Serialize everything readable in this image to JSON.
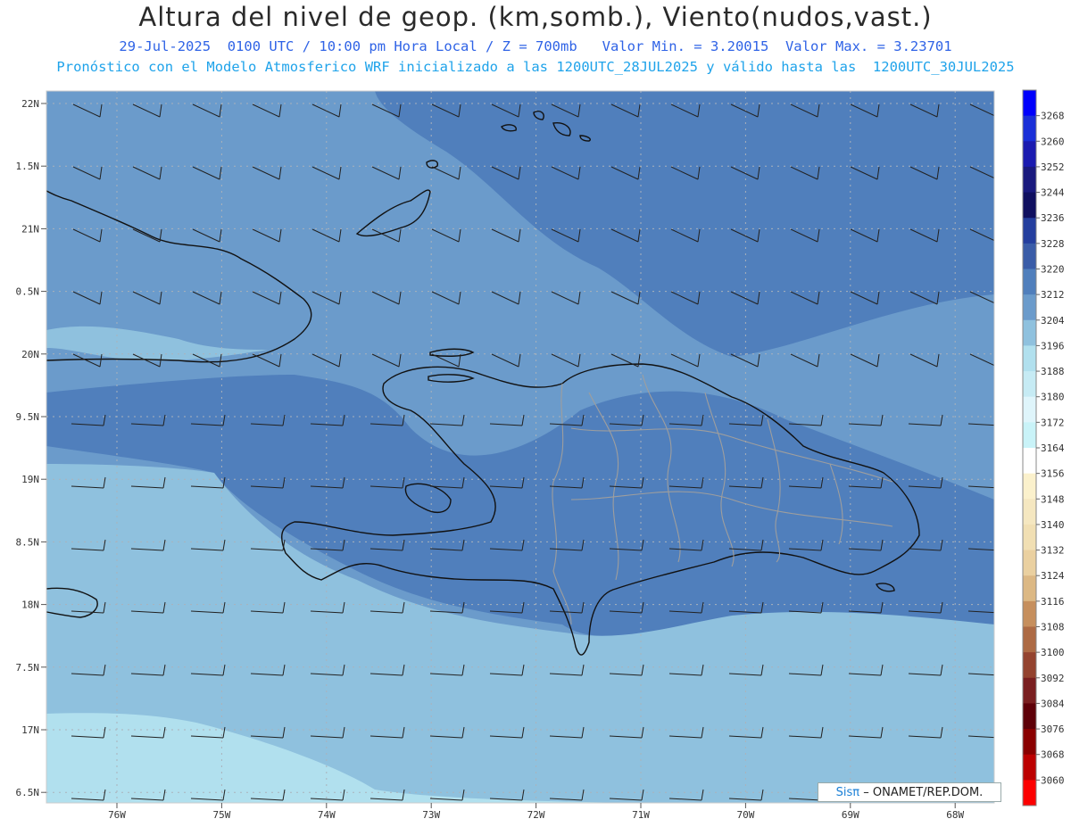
{
  "header": {
    "title": "Altura del nivel de geop. (km,somb.), Viento(nudos,vast.)",
    "line2": "29-Jul-2025  0100 UTC / 10:00 pm Hora Local / Z = 700mb   Valor Min. = 3.20015  Valor Max. = 3.23701",
    "line3": "Pronóstico con el Modelo Atmosferico WRF inicializado a las 1200UTC_28JUL2025 y válido hasta las  1200UTC_30JUL2025"
  },
  "map": {
    "lat_labels": [
      "22N",
      "1.5N",
      "21N",
      "0.5N",
      "20N",
      "9.5N",
      "19N",
      "8.5N",
      "18N",
      "7.5N",
      "17N",
      "6.5N"
    ],
    "lon_labels": [
      "76W",
      "75W",
      "74W",
      "73W",
      "72W",
      "71W",
      "70W",
      "69W",
      "68W"
    ],
    "fill_colors": {
      "c3220": "#507fbc",
      "c3212": "#6b9bcb",
      "c3204": "#8fc1de",
      "c3196": "#b1e0ee"
    }
  },
  "colorbar": {
    "levels": [
      "3268",
      "3260",
      "3252",
      "3244",
      "3236",
      "3228",
      "3220",
      "3212",
      "3204",
      "3196",
      "3188",
      "3180",
      "3172",
      "3164",
      "3156",
      "3148",
      "3140",
      "3132",
      "3124",
      "3116",
      "3108",
      "3100",
      "3092",
      "3084",
      "3076",
      "3068",
      "3060"
    ],
    "colors": [
      "#0000fc",
      "#1a2fd8",
      "#1b1bb0",
      "#1a1a7e",
      "#101060",
      "#243e9e",
      "#3a5ca8",
      "#507fbc",
      "#6b9bcb",
      "#8fc1de",
      "#b1e0ee",
      "#c6ebf4",
      "#dff5fb",
      "#c9f3f8",
      "#ffffff",
      "#fbf1cc",
      "#f5e7c0",
      "#f1dfb3",
      "#ead0a0",
      "#dcb884",
      "#c68f5d",
      "#ad6a44",
      "#94432f",
      "#7a1f20",
      "#5e0008",
      "#8a0000",
      "#bc0000",
      "#fc0000"
    ]
  },
  "credit": {
    "sis": "Sisπ",
    "text": "– ONAMET/REP.DOM."
  }
}
